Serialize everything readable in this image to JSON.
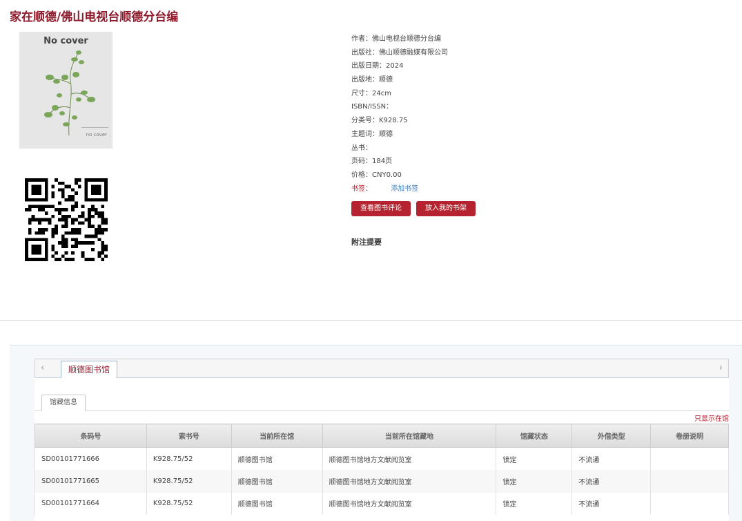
{
  "header": {
    "title": "家在顺德/佛山电视台顺德分台编"
  },
  "cover": {
    "top_text": "No cover",
    "bottom_text": "no cover"
  },
  "meta": [
    {
      "label": "作者：",
      "value": "佛山电视台顺德分台编"
    },
    {
      "label": "出版社：",
      "value": "佛山顺德融媒有限公司"
    },
    {
      "label": "出版日期：",
      "value": "2024"
    },
    {
      "label": "出版地：",
      "value": "顺德"
    },
    {
      "label": "尺寸：",
      "value": "24cm"
    },
    {
      "label": "ISBN/ISSN：",
      "value": ""
    },
    {
      "label": "分类号：",
      "value": "K928.75"
    },
    {
      "label": "主题词：",
      "value": "顺德"
    },
    {
      "label": "丛书：",
      "value": ""
    },
    {
      "label": "页码：",
      "value": "184页"
    },
    {
      "label": "价格：",
      "value": "CNY0.00"
    }
  ],
  "tags": {
    "label": "书签：",
    "add_label": "添加书签"
  },
  "buttons": {
    "view_reviews": "查看图书评论",
    "add_shelf": "放入我的书架"
  },
  "notes": {
    "title": "附注提要"
  },
  "library_tab": {
    "label": "顺德图书馆"
  },
  "holdings_tab": {
    "label": "馆藏信息"
  },
  "filter": {
    "label": "只显示在馆"
  },
  "nav": {
    "left_arrow": "‹",
    "right_arrow": "›"
  },
  "table": {
    "headers": [
      "条码号",
      "索书号",
      "当前所在馆",
      "当前所在馆藏地",
      "馆藏状态",
      "外借类型",
      "卷册说明"
    ],
    "rows": [
      [
        "SD00101771666",
        "K928.75/52",
        "顺德图书馆",
        "顺德图书馆地方文献阅览室",
        "锁定",
        "不流通",
        ""
      ],
      [
        "SD00101771665",
        "K928.75/52",
        "顺德图书馆",
        "顺德图书馆地方文献阅览室",
        "锁定",
        "不流通",
        ""
      ],
      [
        "SD00101771664",
        "K928.75/52",
        "顺德图书馆",
        "顺德图书馆地方文献阅览室",
        "锁定",
        "不流通",
        ""
      ]
    ]
  },
  "colors": {
    "brand": "#8e1b2c",
    "button": "#b4232f",
    "link": "#3a7fc2"
  }
}
